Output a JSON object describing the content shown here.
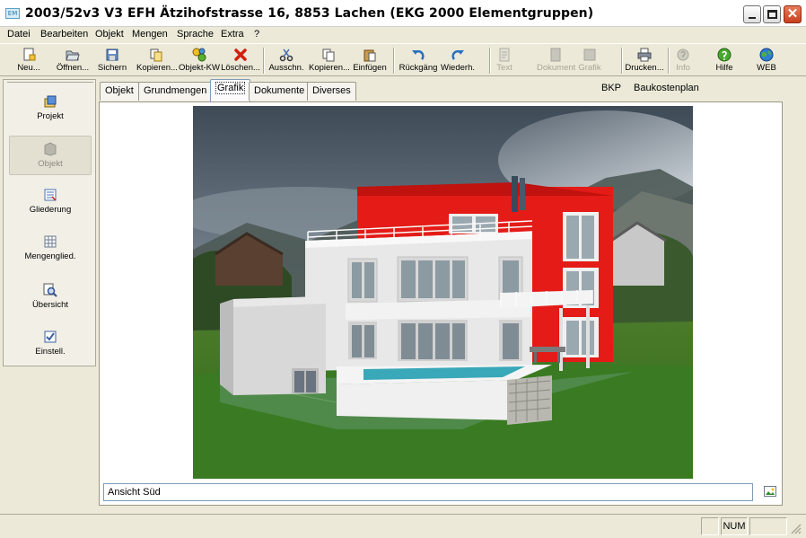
{
  "window": {
    "title": "2003/52v3 V3 EFH Ätzihofstrasse 16, 8853 Lachen (EKG 2000 Elementgruppen)",
    "icon_label": "EM",
    "controls": [
      "minimize-icon",
      "maximize-icon",
      "close-icon"
    ],
    "close_glyph": "✕"
  },
  "menu": [
    "Datei",
    "Bearbeiten",
    "Objekt",
    "Mengen",
    "Sprache",
    "Extra",
    "?"
  ],
  "toolbar": {
    "buttons": [
      {
        "label": "Neu...",
        "icon": "new-document-icon",
        "enabled": true
      },
      {
        "label": "Öffnen...",
        "icon": "open-icon",
        "enabled": true
      },
      {
        "label": "Sichern",
        "icon": "save-icon",
        "enabled": true
      },
      {
        "label": "Kopieren...",
        "icon": "copy-object-icon",
        "enabled": true
      },
      {
        "label": "Objekt-KW",
        "icon": "object-kw-icon",
        "enabled": true
      },
      {
        "label": "Löschen...",
        "icon": "delete-icon",
        "enabled": true
      },
      {
        "label": "Ausschn.",
        "icon": "cut-icon",
        "enabled": true
      },
      {
        "label": "Kopieren...",
        "icon": "copy-icon",
        "enabled": true
      },
      {
        "label": "Einfügen",
        "icon": "paste-icon",
        "enabled": true
      },
      {
        "label": "Rückgäng",
        "icon": "undo-icon",
        "enabled": true
      },
      {
        "label": "Wiederh.",
        "icon": "redo-icon",
        "enabled": true
      },
      {
        "label": "Text",
        "icon": "text-icon",
        "enabled": false
      },
      {
        "label": "Dokument",
        "icon": "document-icon",
        "enabled": false
      },
      {
        "label": "Grafik",
        "icon": "graphic-icon",
        "enabled": false
      },
      {
        "label": "Drucken...",
        "icon": "print-icon",
        "enabled": true
      },
      {
        "label": "Info",
        "icon": "info-icon",
        "enabled": false
      },
      {
        "label": "Hilfe",
        "icon": "help-icon",
        "enabled": true
      },
      {
        "label": "WEB",
        "icon": "web-globe-icon",
        "enabled": true
      }
    ]
  },
  "sidebar": {
    "items": [
      {
        "label": "Projekt",
        "icon": "project-icon",
        "active": false
      },
      {
        "label": "Objekt",
        "icon": "object-icon",
        "active": true
      },
      {
        "label": "Gliederung",
        "icon": "structure-icon",
        "active": false
      },
      {
        "label": "Mengenglied.",
        "icon": "quantity-structure-icon",
        "active": false
      },
      {
        "label": "Übersicht",
        "icon": "overview-icon",
        "active": false
      },
      {
        "label": "Einstell.",
        "icon": "settings-icon",
        "active": false
      }
    ]
  },
  "tabs": [
    {
      "label": "Objekt",
      "active": false
    },
    {
      "label": "Grundmengen",
      "active": false
    },
    {
      "label": "Grafik",
      "active": true
    },
    {
      "label": "Dokumente",
      "active": false
    },
    {
      "label": "Diverses",
      "active": false
    }
  ],
  "code": {
    "short": "BKP",
    "long": "Baukostenplan"
  },
  "graphic": {
    "caption": "Ansicht Süd",
    "image": "3d-house-rendering",
    "accent_color": "#e41b17"
  },
  "statusbar": {
    "panels": [
      "",
      "NUM",
      ""
    ]
  },
  "colors": {
    "window_bg": "#ece9d8",
    "border": "#aca899",
    "accent_blue": "#7f9db9"
  }
}
